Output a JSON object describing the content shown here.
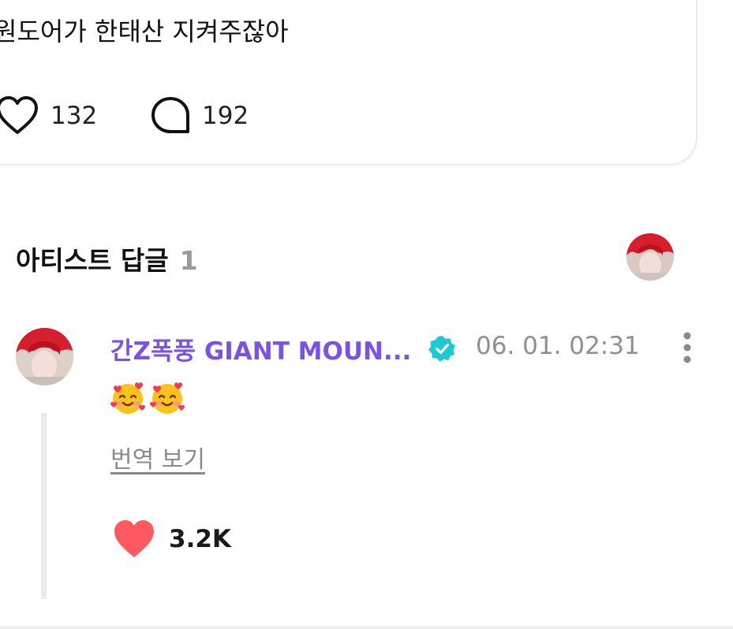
{
  "post": {
    "text": "원도어가 한태산 지켜주잖아",
    "like_count": "132",
    "comment_count": "192",
    "icons": {
      "like": "heart-outline-icon",
      "comment": "speech-bubble-icon"
    }
  },
  "artist_replies": {
    "title": "아티스트 답글",
    "count": "1"
  },
  "reply": {
    "author": "간Z폭풍 GIANT MOUN...",
    "timestamp": "06. 01. 02:31",
    "content_emoji": [
      "smiling-face-with-hearts",
      "smiling-face-with-hearts"
    ],
    "translate_label": "번역 보기",
    "like_count": "3.2K",
    "icons": {
      "verified": "verified-badge-icon",
      "more": "more-vertical-icon",
      "like": "heart-filled-icon"
    }
  },
  "colors": {
    "author_name": "#7b53e2",
    "verified_badge": "#1fc9d2",
    "like_heart": "#ff5a5f",
    "muted_text": "#8f8f8f"
  }
}
